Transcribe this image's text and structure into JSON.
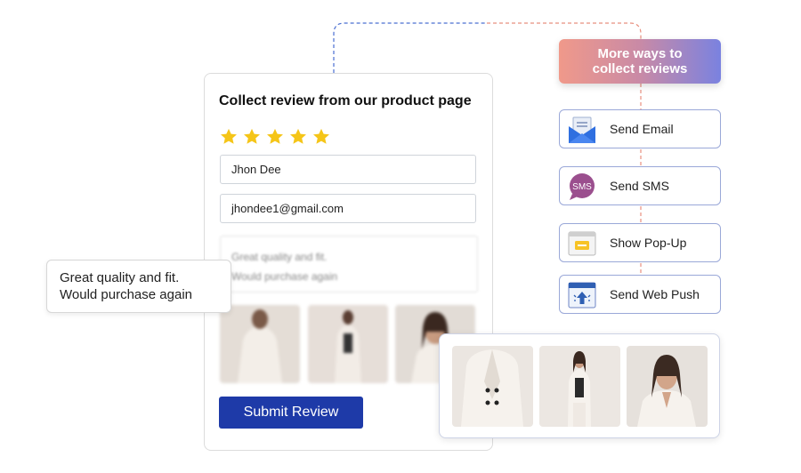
{
  "form": {
    "title": "Collect review from our product page",
    "rating": 5,
    "name_value": "Jhon Dee",
    "email_value": "jhondee1@gmail.com",
    "review_line1": "Great quality and fit.",
    "review_line2": "Would purchase again",
    "submit_label": "Submit Review"
  },
  "bubble": {
    "line1": "Great quality and fit.",
    "line2": "Would purchase again"
  },
  "more_ways": {
    "line1": "More ways to",
    "line2": "collect reviews"
  },
  "channels": [
    {
      "label": "Send Email",
      "icon": "envelope-icon"
    },
    {
      "label": "Send SMS",
      "icon": "sms-bubble-icon",
      "icon_text": "SMS"
    },
    {
      "label": "Show Pop-Up",
      "icon": "popup-window-icon"
    },
    {
      "label": "Send Web Push",
      "icon": "web-push-icon"
    }
  ],
  "colors": {
    "submit_bg": "#1e3aa8",
    "star": "#f5c518",
    "connector_blue": "#4a6fd1",
    "connector_red": "#e8907f",
    "channel_border": "#9aa8d8"
  }
}
